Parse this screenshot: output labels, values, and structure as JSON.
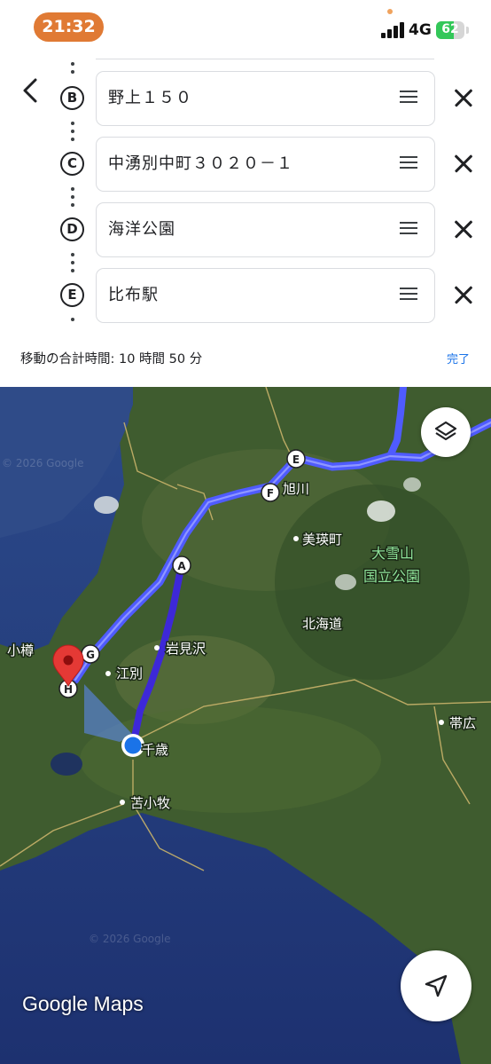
{
  "status_bar": {
    "time": "21:32",
    "network": "4G",
    "battery": "62",
    "battery_level": 0.62
  },
  "route": {
    "stops": [
      {
        "letter": "B",
        "name": "野上１５０"
      },
      {
        "letter": "C",
        "name": "中湧別中町３０２０－１"
      },
      {
        "letter": "D",
        "name": "海洋公園"
      },
      {
        "letter": "E",
        "name": "比布駅"
      }
    ],
    "total_time": "移動の合計時間: 10 時間 50 分",
    "done_label": "完了"
  },
  "map": {
    "place_labels": {
      "asahikawa": "旭川",
      "biei": "美瑛町",
      "daisetsuzan_1": "大雪山",
      "daisetsuzan_2": "国立公園",
      "hokkaido": "北海道",
      "iwamizawa": "岩見沢",
      "otaru": "小樽",
      "ebetsu": "江別",
      "chitose": "千歳",
      "tomakomai": "苫小牧",
      "obihiro": "帯広"
    },
    "route_markers": [
      "A",
      "E",
      "F",
      "G",
      "H"
    ],
    "watermark": "© 2026 Google",
    "logo": "Google Maps",
    "colors": {
      "route": "#4f5bff",
      "route_dark": "#3d28d8",
      "destination_pin": "#e53935",
      "current_location": "#1a73e8",
      "land": "#3d5a2e",
      "sea": "#233a78"
    }
  },
  "icons": {
    "back": "chevron-left-icon",
    "layers": "layers-icon",
    "navigate": "navigation-arrow-icon",
    "drag": "drag-handle-icon",
    "remove": "close-icon"
  }
}
